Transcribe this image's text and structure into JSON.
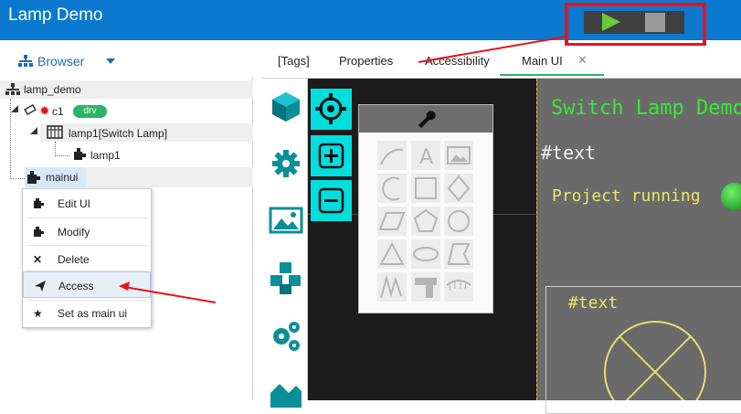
{
  "app": {
    "title": "Lamp Demo"
  },
  "colors": {
    "titlebar": "#0b79d0",
    "accent_green": "#27b566",
    "highlight_red": "#e8141d",
    "tool_cyan": "#00dede"
  },
  "toolbar": {
    "run_icon": "play-icon",
    "stop_icon": "stop-icon"
  },
  "browser": {
    "label": "Browser",
    "icon": "sitemap-icon"
  },
  "tree": {
    "root": "lamp_demo",
    "driver": "c1",
    "driver_badge": "drv",
    "group": "lamp1[Switch Lamp]",
    "leaf": "lamp1",
    "ui": "mainui"
  },
  "context_menu": {
    "items": [
      {
        "label": "Edit UI",
        "icon": "puzzle-icon"
      },
      {
        "label": "Modify",
        "icon": "puzzle-icon"
      },
      {
        "label": "Delete",
        "icon": "close-icon"
      },
      {
        "label": "Access",
        "icon": "send-icon"
      },
      {
        "label": "Set as main ui",
        "icon": "star-icon"
      }
    ]
  },
  "tabs": [
    {
      "label": "[Tags]"
    },
    {
      "label": "Properties"
    },
    {
      "label": "Accessibility"
    },
    {
      "label": "Main UI",
      "closable": true
    }
  ],
  "screen": {
    "title": "Switch Lamp Demo",
    "text1": "#text",
    "running": "Project running",
    "text2": "#text"
  }
}
